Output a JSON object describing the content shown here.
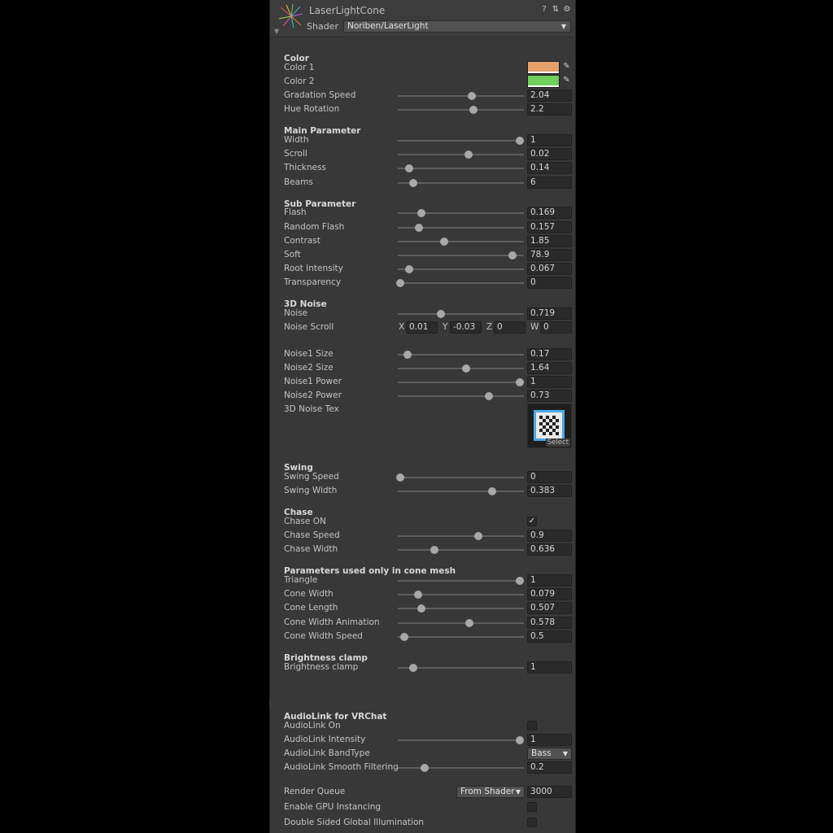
{
  "header": {
    "title": "LaserLightCone",
    "shader_label": "Shader",
    "shader_value": "Noriben/LaserLight"
  },
  "sections": {
    "color": "Color",
    "main": "Main Parameter",
    "sub": "Sub Parameter",
    "noise3d": "3D Noise",
    "swing": "Swing",
    "chase": "Chase",
    "cone": "Parameters used only in cone mesh",
    "brightness": "Brightness clamp",
    "audiolink": "AudioLink for VRChat"
  },
  "colors": {
    "color1": {
      "label": "Color 1",
      "hex": "#e6a16b"
    },
    "color2": {
      "label": "Color 2",
      "hex": "#6fd05a"
    }
  },
  "sliders": {
    "gradation_speed": {
      "label": "Gradation Speed",
      "value": "2.04",
      "pos": 0.59
    },
    "hue_rotation": {
      "label": "Hue Rotation",
      "value": "2.2",
      "pos": 0.6
    },
    "width": {
      "label": "Width",
      "value": "1",
      "pos": 0.97
    },
    "scroll": {
      "label": "Scroll",
      "value": "0.02",
      "pos": 0.56
    },
    "thickness": {
      "label": "Thickness",
      "value": "0.14",
      "pos": 0.09
    },
    "beams": {
      "label": "Beams",
      "value": "6",
      "pos": 0.12
    },
    "flash": {
      "label": "Flash",
      "value": "0.169",
      "pos": 0.19
    },
    "random_flash": {
      "label": "Random Flash",
      "value": "0.157",
      "pos": 0.17
    },
    "contrast": {
      "label": "Contrast",
      "value": "1.85",
      "pos": 0.37
    },
    "soft": {
      "label": "Soft",
      "value": "78.9",
      "pos": 0.91
    },
    "root_intensity": {
      "label": "Root Intensity",
      "value": "0.067",
      "pos": 0.09
    },
    "transparency": {
      "label": "Transparency",
      "value": "0",
      "pos": 0.02
    },
    "noise": {
      "label": "Noise",
      "value": "0.719",
      "pos": 0.34
    },
    "noise1_size": {
      "label": "Noise1 Size",
      "value": "0.17",
      "pos": 0.08
    },
    "noise2_size": {
      "label": "Noise2 Size",
      "value": "1.64",
      "pos": 0.54
    },
    "noise1_power": {
      "label": "Noise1 Power",
      "value": "1",
      "pos": 0.97
    },
    "noise2_power": {
      "label": "Noise2 Power",
      "value": "0.73",
      "pos": 0.72
    },
    "swing_speed": {
      "label": "Swing Speed",
      "value": "0",
      "pos": 0.02
    },
    "swing_width": {
      "label": "Swing Width",
      "value": "0.383",
      "pos": 0.75
    },
    "chase_speed": {
      "label": "Chase Speed",
      "value": "0.9",
      "pos": 0.64
    },
    "chase_width": {
      "label": "Chase Width",
      "value": "0.636",
      "pos": 0.29
    },
    "triangle": {
      "label": "Triangle",
      "value": "1",
      "pos": 0.97
    },
    "cone_width": {
      "label": "Cone Width",
      "value": "0.079",
      "pos": 0.16
    },
    "cone_length": {
      "label": "Cone Length",
      "value": "0.507",
      "pos": 0.19
    },
    "cone_width_animation": {
      "label": "Cone Width Animation",
      "value": "0.578",
      "pos": 0.57
    },
    "cone_width_speed": {
      "label": "Cone Width Speed",
      "value": "0.5",
      "pos": 0.05
    },
    "brightness_clamp": {
      "label": "Brightness clamp",
      "value": "1",
      "pos": 0.12
    },
    "audiolink_intensity": {
      "label": "AudioLink Intensity",
      "value": "1",
      "pos": 0.97
    },
    "audiolink_smooth": {
      "label": "AudioLink Smooth Filtering",
      "value": "0.2",
      "pos": 0.21
    }
  },
  "noise_scroll": {
    "label": "Noise Scroll",
    "x_label": "X",
    "x": "0.01",
    "y_label": "Y",
    "y": "-0.03",
    "z_label": "Z",
    "z": "0",
    "w_label": "W",
    "w": "0"
  },
  "noise_tex": {
    "label": "3D Noise Tex",
    "select": "Select"
  },
  "chase_on": {
    "label": "Chase ON",
    "checked": true,
    "glyph": "✓"
  },
  "audiolink_on": {
    "label": "AudioLink On",
    "checked": false
  },
  "audiolink_band": {
    "label": "AudioLink BandType",
    "value": "Bass"
  },
  "render_queue": {
    "label": "Render Queue",
    "mode": "From Shader",
    "value": "3000"
  },
  "gpu_instancing": {
    "label": "Enable GPU Instancing",
    "checked": false
  },
  "double_sided_gi": {
    "label": "Double Sided Global Illumination",
    "checked": false
  }
}
